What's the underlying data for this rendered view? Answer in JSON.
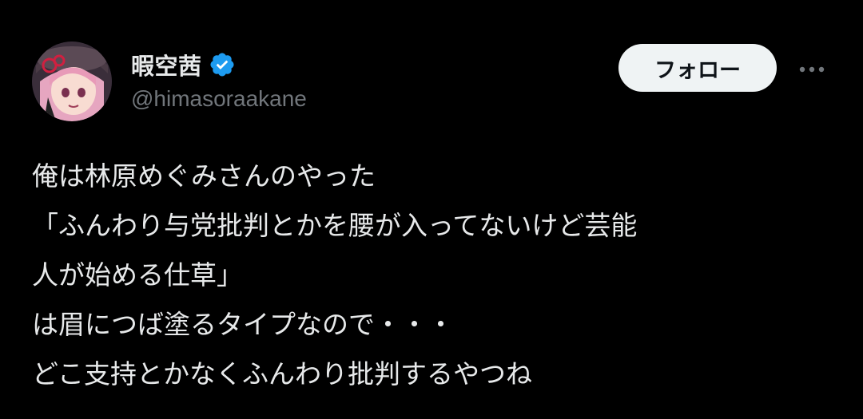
{
  "author": {
    "display_name": "暇空茜",
    "handle": "@himasoraakane",
    "verified": true,
    "avatar_icon": "anime-avatar-icon",
    "verified_icon": "verified-badge-icon",
    "verified_color": "#1d9bf0"
  },
  "actions": {
    "follow_label": "フォロー",
    "more_icon": "more-dots-icon"
  },
  "tweet": {
    "lines": [
      "俺は林原めぐみさんのやった",
      "「ふんわり与党批判とかを腰が入ってないけど芸能",
      "人が始める仕草」",
      "は眉につば塗るタイプなので・・・",
      "どこ支持とかなくふんわり批判するやつね"
    ]
  },
  "colors": {
    "background": "#000000",
    "text_primary": "#e7e9ea",
    "text_secondary": "#71767b",
    "button_bg": "#eff3f4",
    "button_text": "#0f1419"
  }
}
